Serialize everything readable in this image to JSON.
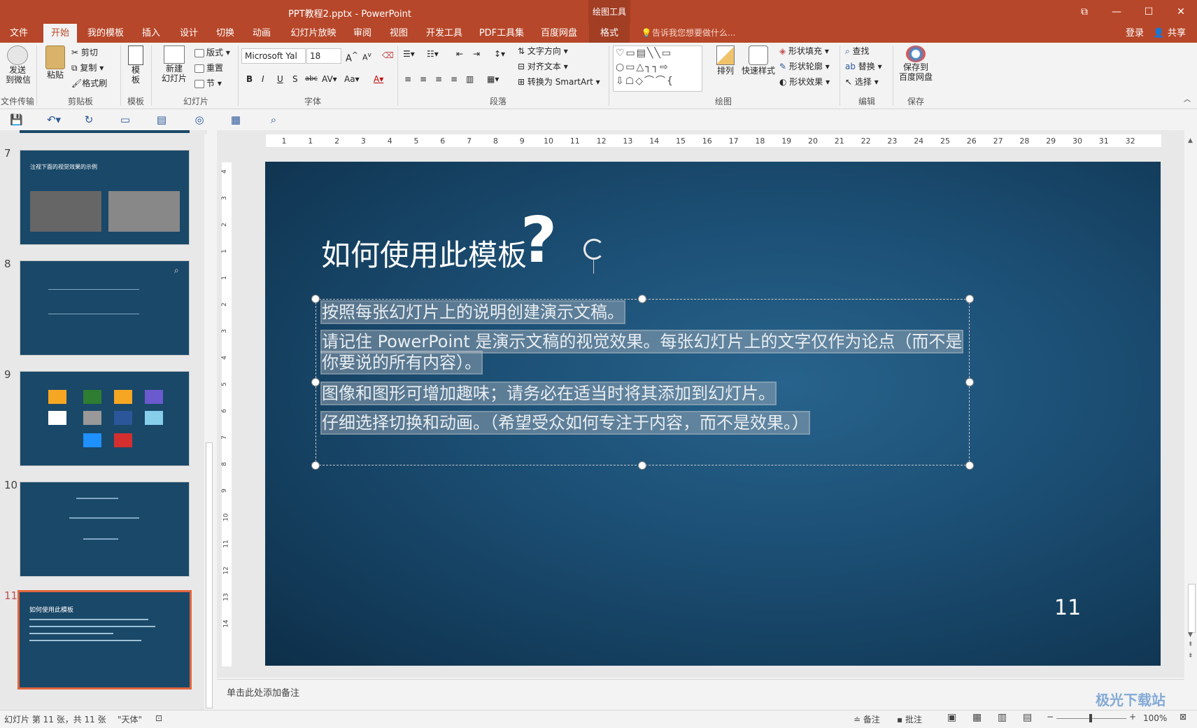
{
  "titlebar": {
    "title": "PPT教程2.pptx - PowerPoint",
    "context_group": "绘图工具",
    "restore": "⧉",
    "minimize": "—",
    "maximize": "☐",
    "close": "✕"
  },
  "menu": {
    "tabs": [
      "文件",
      "开始",
      "我的模板",
      "插入",
      "设计",
      "切换",
      "动画",
      "幻灯片放映",
      "审阅",
      "视图",
      "开发工具",
      "PDF工具集",
      "百度网盘",
      "格式"
    ],
    "active": "开始",
    "tellme": "告诉我您想要做什么...",
    "login": "登录",
    "share": "共享"
  },
  "ribbon": {
    "groups": {
      "send": "文件传输",
      "clipboard": "剪贴板",
      "template": "模板",
      "slides": "幻灯片",
      "font": "字体",
      "paragraph": "段落",
      "drawing": "绘图",
      "edit": "编辑",
      "save": "保存"
    },
    "send_btn": "发送\n到微信",
    "paste": "粘贴",
    "cut": "剪切",
    "copy": "复制",
    "format_painter": "格式刷",
    "template_btn": "模\n板",
    "new_slide": "新建\n幻灯片",
    "layout": "版式",
    "reset": "重置",
    "section": "节",
    "font_name": "Microsoft Yal",
    "font_size": "18",
    "text_direction": "文字方向",
    "align_text": "对齐文本",
    "smartart": "转换为 SmartArt",
    "arrange": "排列",
    "quick_styles": "快速样式",
    "shape_fill": "形状填充",
    "shape_outline": "形状轮廓",
    "shape_effect": "形状效果",
    "find": "查找",
    "replace": "替换",
    "select": "选择",
    "save_baidu": "保存到\n百度网盘"
  },
  "thumbnails": [
    {
      "num": "7",
      "title": "注视下面的视觉效果的示例"
    },
    {
      "num": "8"
    },
    {
      "num": "9"
    },
    {
      "num": "10"
    },
    {
      "num": "11",
      "title": "如何使用此模板"
    }
  ],
  "slide": {
    "title": "如何使用此模板",
    "question": "?",
    "bullets": [
      "按照每张幻灯片上的说明创建演示文稿。",
      "请记住 PowerPoint 是演示文稿的视觉效果。每张幻灯片上的文字仅作为论点（而不是",
      "你要说的所有内容）。",
      "图像和图形可增加趣味；请务必在适当时将其添加到幻灯片。",
      "仔细选择切换和动画。（希望受众如何专注于内容，而不是效果。）"
    ],
    "page_number": "11"
  },
  "notes": {
    "placeholder": "单击此处添加备注"
  },
  "status": {
    "slide_info": "幻灯片 第 11 张，共 11 张",
    "theme": "\"天体\"",
    "notes_btn": "备注",
    "comments_btn": "批注",
    "zoom": "100%"
  },
  "ruler": {
    "h_ticks": [
      "1",
      "1",
      "2",
      "3",
      "4",
      "5",
      "6",
      "7",
      "8",
      "9",
      "10",
      "11",
      "12",
      "13",
      "14",
      "15",
      "16",
      "17",
      "18",
      "19",
      "20",
      "21",
      "22",
      "23",
      "24",
      "25",
      "26",
      "27",
      "28",
      "29",
      "30",
      "31",
      "32"
    ],
    "v_ticks": [
      "4",
      "3",
      "2",
      "1",
      "1",
      "2",
      "3",
      "4",
      "5",
      "6",
      "7",
      "8",
      "9",
      "10",
      "11",
      "12",
      "13",
      "14"
    ]
  },
  "watermark": "极光下载站"
}
